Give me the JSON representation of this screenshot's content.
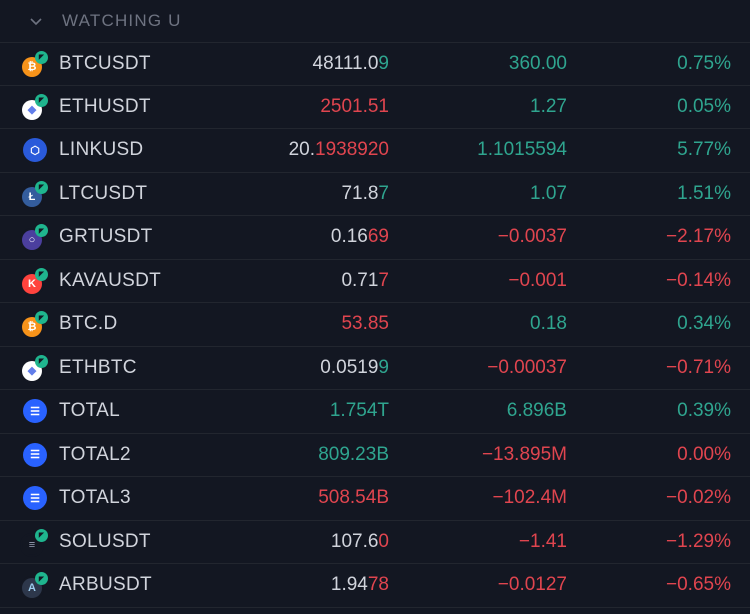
{
  "list": {
    "title": "WATCHING U",
    "collapse_icon": "chevron-down-icon"
  },
  "colors": {
    "background": "#131722",
    "text": "#d1d4dc",
    "up": "#2fa58f",
    "down": "#e0454f",
    "header": "#6e7381"
  },
  "rows": [
    {
      "symbol": "BTCUSDT",
      "icon": "bitcoin-icon",
      "last_a": "48111.0",
      "last_b": "9",
      "last_dir": "up",
      "change": "360.00",
      "change_dir": "up",
      "percent": "0.75%",
      "pct_dir": "up"
    },
    {
      "symbol": "ETHUSDT",
      "icon": "ethereum-icon",
      "last_a": "",
      "last_b": "2501.51",
      "last_dir": "down",
      "change": "1.27",
      "change_dir": "up",
      "percent": "0.05%",
      "pct_dir": "up"
    },
    {
      "symbol": "LINKUSD",
      "icon": "chainlink-icon",
      "last_a": "20.",
      "last_b": "1938920",
      "last_dir": "down",
      "change": "1.1015594",
      "change_dir": "up",
      "percent": "5.77%",
      "pct_dir": "up"
    },
    {
      "symbol": "LTCUSDT",
      "icon": "litecoin-icon",
      "last_a": "71.8",
      "last_b": "7",
      "last_dir": "up",
      "change": "1.07",
      "change_dir": "up",
      "percent": "1.51%",
      "pct_dir": "up"
    },
    {
      "symbol": "GRTUSDT",
      "icon": "the-graph-icon",
      "last_a": "0.16",
      "last_b": "69",
      "last_dir": "down",
      "change": "−0.0037",
      "change_dir": "down",
      "percent": "−2.17%",
      "pct_dir": "down"
    },
    {
      "symbol": "KAVAUSDT",
      "icon": "kava-icon",
      "last_a": "0.71",
      "last_b": "7",
      "last_dir": "down",
      "change": "−0.001",
      "change_dir": "down",
      "percent": "−0.14%",
      "pct_dir": "down"
    },
    {
      "symbol": "BTC.D",
      "icon": "bitcoin-icon",
      "last_a": "",
      "last_b": "53.85",
      "last_dir": "down",
      "change": "0.18",
      "change_dir": "up",
      "percent": "0.34%",
      "pct_dir": "up"
    },
    {
      "symbol": "ETHBTC",
      "icon": "ethereum-icon",
      "last_a": "0.0519",
      "last_b": "9",
      "last_dir": "up",
      "change": "−0.00037",
      "change_dir": "down",
      "percent": "−0.71%",
      "pct_dir": "down"
    },
    {
      "symbol": "TOTAL",
      "icon": "crypto-cap-icon",
      "last_a": "",
      "last_b": "1.754T",
      "last_dir": "up",
      "change": "6.896B",
      "change_dir": "up",
      "percent": "0.39%",
      "pct_dir": "up"
    },
    {
      "symbol": "TOTAL2",
      "icon": "crypto-cap-icon",
      "last_a": "",
      "last_b": "809.23B",
      "last_dir": "up",
      "change": "−13.895M",
      "change_dir": "down",
      "percent": "0.00%",
      "pct_dir": "down"
    },
    {
      "symbol": "TOTAL3",
      "icon": "crypto-cap-icon",
      "last_a": "",
      "last_b": "508.54B",
      "last_dir": "down",
      "change": "−102.4M",
      "change_dir": "down",
      "percent": "−0.02%",
      "pct_dir": "down"
    },
    {
      "symbol": "SOLUSDT",
      "icon": "solana-icon",
      "last_a": "107.6",
      "last_b": "0",
      "last_dir": "down",
      "change": "−1.41",
      "change_dir": "down",
      "percent": "−1.29%",
      "pct_dir": "down"
    },
    {
      "symbol": "ARBUSDT",
      "icon": "arbitrum-icon",
      "last_a": "1.94",
      "last_b": "78",
      "last_dir": "down",
      "change": "−0.0127",
      "change_dir": "down",
      "percent": "−0.65%",
      "pct_dir": "down"
    }
  ]
}
